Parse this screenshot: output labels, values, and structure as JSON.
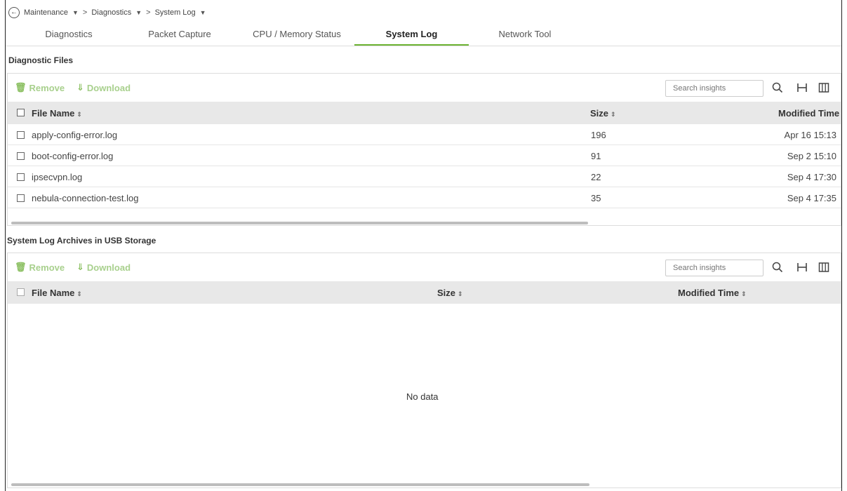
{
  "breadcrumb": {
    "items": [
      "Maintenance",
      "Diagnostics",
      "System Log"
    ],
    "separator": ">"
  },
  "tabs": [
    {
      "label": "Diagnostics"
    },
    {
      "label": "Packet Capture"
    },
    {
      "label": "CPU / Memory Status"
    },
    {
      "label": "System Log",
      "active": true
    },
    {
      "label": "Network Tool"
    }
  ],
  "diagnostic_files": {
    "title": "Diagnostic Files",
    "toolbar": {
      "remove_label": "Remove",
      "download_label": "Download",
      "search_placeholder": "Search insights"
    },
    "columns": {
      "name": "File Name",
      "size": "Size",
      "modified": "Modified Time"
    },
    "rows": [
      {
        "name": "apply-config-error.log",
        "size": "196",
        "modified": "Apr 16 15:13"
      },
      {
        "name": "boot-config-error.log",
        "size": "91",
        "modified": "Sep 2 15:10"
      },
      {
        "name": "ipsecvpn.log",
        "size": "22",
        "modified": "Sep 4 17:30"
      },
      {
        "name": "nebula-connection-test.log",
        "size": "35",
        "modified": "Sep 4 17:35"
      }
    ]
  },
  "usb_archives": {
    "title": "System Log Archives in USB Storage",
    "toolbar": {
      "remove_label": "Remove",
      "download_label": "Download",
      "search_placeholder": "Search insights"
    },
    "columns": {
      "name": "File Name",
      "size": "Size",
      "modified": "Modified Time"
    },
    "empty_text": "No data"
  },
  "colors": {
    "accent": "#6cb332",
    "toolbar_disabled": "#a8d08d",
    "header_bg": "#e8e8e8"
  },
  "icons": [
    "back-arrow-icon",
    "chevron-down-icon",
    "trash-icon",
    "download-icon",
    "search-icon",
    "fit-columns-icon",
    "columns-icon",
    "sort-icon"
  ]
}
